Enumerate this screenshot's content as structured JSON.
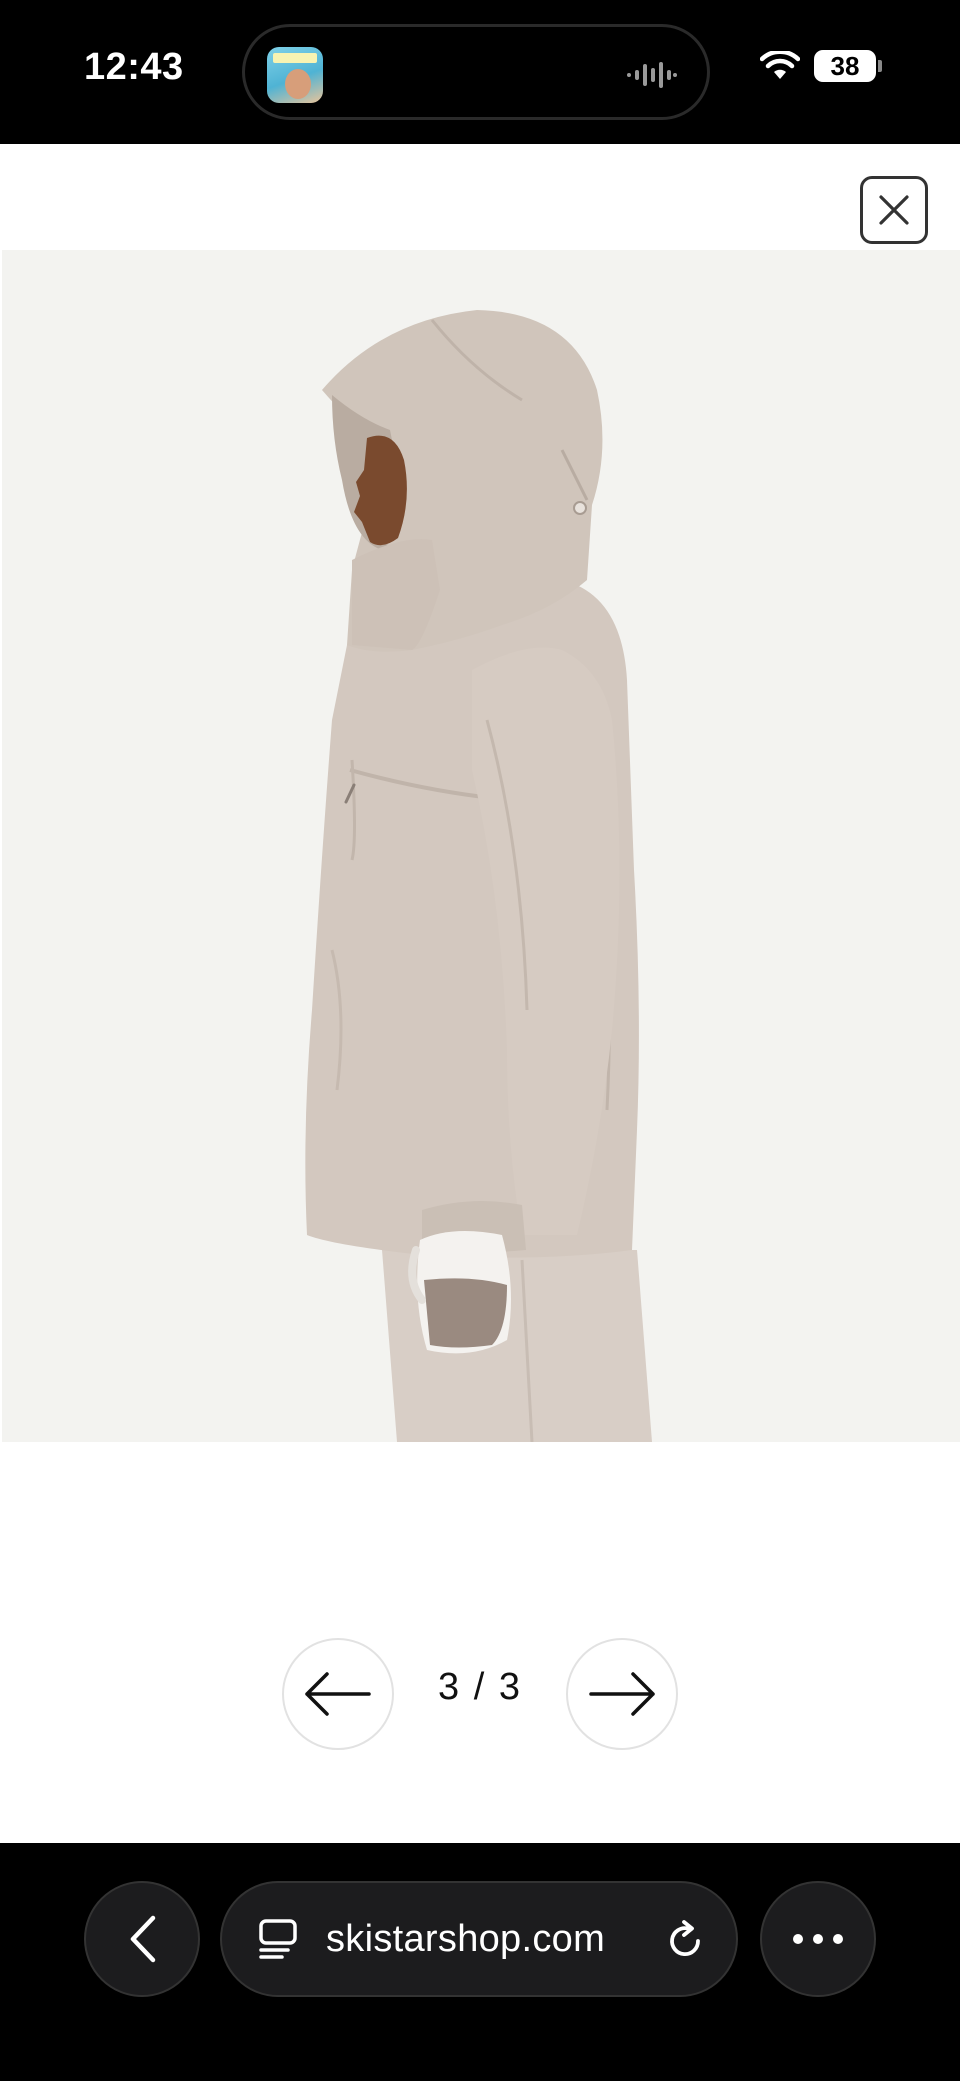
{
  "status_bar": {
    "time": "12:43",
    "battery_level": "38",
    "now_playing_art_icon": "podcast-artwork-icon",
    "audio_wave_icon": "audio-waveform-icon",
    "wifi_icon": "wifi-icon"
  },
  "gallery": {
    "close_icon": "close-icon",
    "counter": "3 / 3",
    "current_index": 3,
    "total": 3,
    "prev_icon": "arrow-left-icon",
    "next_icon": "arrow-right-icon"
  },
  "product_image": {
    "subject": "hooded-rain-jacket-side-view",
    "background_color": "#f3f3f0",
    "jacket_color": "#d3c8bf"
  },
  "browser": {
    "url": "skistarshop.com",
    "back_icon": "chevron-left-icon",
    "tabs_icon": "page-tabs-icon",
    "reload_icon": "reload-icon",
    "more_icon": "more-dots-icon"
  }
}
